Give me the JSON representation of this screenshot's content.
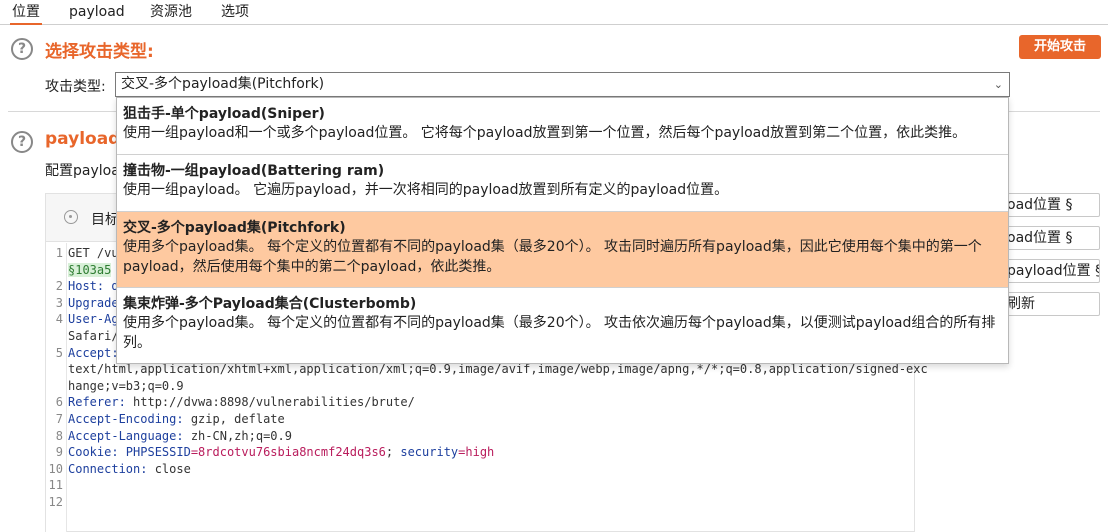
{
  "tabs": [
    "位置",
    "payload",
    "资源池",
    "选项"
  ],
  "section1": {
    "title": "选择攻击类型:",
    "start_button": "开始攻击",
    "attack_type_label": "攻击类型:",
    "selected_value": "交叉-多个payload集(Pitchfork)"
  },
  "section2": {
    "title_visible": "payload(",
    "desc_visible": "配置payloa"
  },
  "editor": {
    "target_label_visible": "目标"
  },
  "side_buttons": [
    "oad位置 §",
    "oad位置 §",
    "payload位置 §",
    "刷新"
  ],
  "code_lines": [
    {
      "n": "1",
      "parts": [
        {
          "t": "GET /vu",
          "c": "v"
        }
      ]
    },
    {
      "n": "",
      "parts": [
        {
          "t": "§103a5",
          "c": "marker"
        }
      ]
    },
    {
      "n": "2",
      "parts": [
        {
          "t": "Host: d",
          "c": "k"
        }
      ]
    },
    {
      "n": "3",
      "parts": [
        {
          "t": "Upgrade",
          "c": "k"
        }
      ]
    },
    {
      "n": "4",
      "parts": [
        {
          "t": "User-Ag",
          "c": "k"
        }
      ]
    },
    {
      "n": "",
      "parts": [
        {
          "t": "Safari/",
          "c": "v"
        }
      ]
    },
    {
      "n": "5",
      "parts": [
        {
          "t": "Accept:",
          "c": "k"
        }
      ]
    },
    {
      "n": "",
      "parts": [
        {
          "t": "text/html,application/xhtml+xml,application/xml;q=0.9,image/avif,image/webp,image/apng,*/*;q=0.8,application/signed-exc",
          "c": "v"
        }
      ]
    },
    {
      "n": "",
      "parts": [
        {
          "t": "hange;v=b3;q=0.9",
          "c": "v"
        }
      ]
    },
    {
      "n": "6",
      "parts": [
        {
          "t": "Referer: ",
          "c": "k"
        },
        {
          "t": "http://dvwa:8898/vulnerabilities/brute/",
          "c": "v"
        }
      ]
    },
    {
      "n": "7",
      "parts": [
        {
          "t": "Accept-Encoding: ",
          "c": "k"
        },
        {
          "t": "gzip, deflate",
          "c": "v"
        }
      ]
    },
    {
      "n": "8",
      "parts": [
        {
          "t": "Accept-Language: ",
          "c": "k"
        },
        {
          "t": "zh-CN,zh;q=0.9",
          "c": "v"
        }
      ]
    },
    {
      "n": "9",
      "parts": [
        {
          "t": "Cookie: ",
          "c": "k"
        },
        {
          "t": "PHPSESSID",
          "c": "k"
        },
        {
          "t": "=8rdcotvu76sbia8ncmf24dq3s6",
          "c": "v-red"
        },
        {
          "t": "; ",
          "c": "v"
        },
        {
          "t": "security",
          "c": "k"
        },
        {
          "t": "=high",
          "c": "v-red"
        }
      ]
    },
    {
      "n": "10",
      "parts": [
        {
          "t": "Connection: ",
          "c": "k"
        },
        {
          "t": "close",
          "c": "v"
        }
      ]
    },
    {
      "n": "11",
      "parts": []
    },
    {
      "n": "12",
      "parts": []
    }
  ],
  "dropdown": {
    "options": [
      {
        "title": "狙击手-单个payload(Sniper)",
        "desc": "使用一组payload和一个或多个payload位置。 它将每个payload放置到第一个位置，然后每个payload放置到第二个位置，依此类推。"
      },
      {
        "title": "撞击物-一组payload(Battering ram)",
        "desc": "使用一组payload。 它遍历payload，并一次将相同的payload放置到所有定义的payload位置。"
      },
      {
        "title": "交叉-多个payload集(Pitchfork)",
        "desc": "使用多个payload集。 每个定义的位置都有不同的payload集（最多20个）。 攻击同时遍历所有payload集，因此它使用每个集中的第一个payload，然后使用每个集中的第二个payload，依此类推。"
      },
      {
        "title": "集束炸弹-多个Payload集合(Clusterbomb)",
        "desc": "使用多个payload集。 每个定义的位置都有不同的payload集（最多20个）。 攻击依次遍历每个payload集，以便测试payload组合的所有排列。"
      }
    ]
  },
  "colors": {
    "accent": "#e8662b",
    "selected_option_bg": "#fec9a0"
  }
}
